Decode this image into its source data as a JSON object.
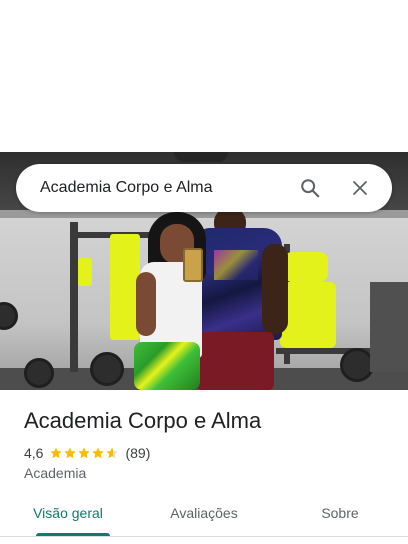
{
  "search": {
    "query": "Academia Corpo e Alma",
    "search_icon": "search-icon",
    "close_icon": "close-icon"
  },
  "place": {
    "name": "Academia Corpo e Alma",
    "rating": "4,6",
    "rating_value": 4.6,
    "stars_max": 5,
    "review_count": "(89)",
    "category": "Academia"
  },
  "tabs": [
    {
      "label": "Visão geral",
      "active": true
    },
    {
      "label": "Avaliações",
      "active": false
    },
    {
      "label": "Sobre",
      "active": false
    }
  ],
  "colors": {
    "accent": "#0b7a72",
    "star": "#fbbc04",
    "star_empty": "#dadce0"
  }
}
